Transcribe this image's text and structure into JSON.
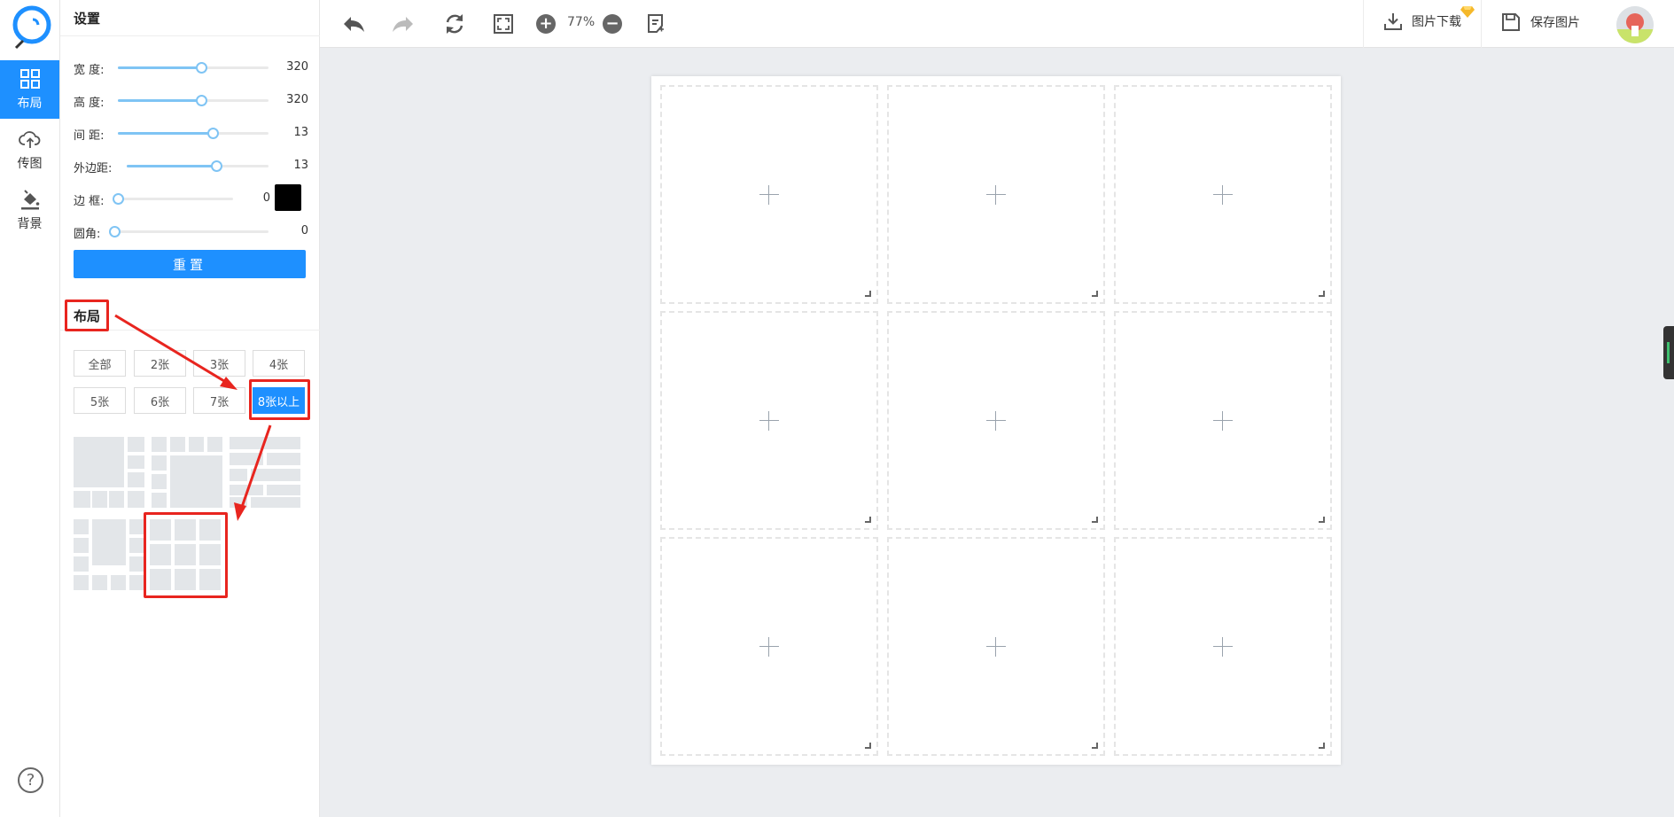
{
  "rail": {
    "items": [
      {
        "label": "布局",
        "icon": "grid-icon"
      },
      {
        "label": "传图",
        "icon": "cloud-upload-icon"
      },
      {
        "label": "背景",
        "icon": "paint-bucket-icon"
      }
    ],
    "help": "?"
  },
  "panel": {
    "title": "设置",
    "sliders": [
      {
        "label": "宽 度:",
        "value": "320",
        "level": 0.55
      },
      {
        "label": "高 度:",
        "value": "320",
        "level": 0.55
      },
      {
        "label": "间 距:",
        "value": "13",
        "level": 0.63
      },
      {
        "label": "外边距:",
        "value": "13",
        "level": 0.63
      },
      {
        "label": "边 框:",
        "value": "0",
        "level": 0
      },
      {
        "label": "圆角:",
        "value": "0",
        "level": 0
      }
    ],
    "border_color": "#000000",
    "reset_label": "重置",
    "layout_title": "布局",
    "filters": [
      "全部",
      "2张",
      "3张",
      "4张",
      "5张",
      "6张",
      "7张",
      "8张以上"
    ],
    "active_filter": "8张以上"
  },
  "toolbar": {
    "zoom": "77%",
    "zoom_in": "+",
    "zoom_out": "−",
    "download_label": "图片下载",
    "save_label": "保存图片"
  },
  "colors": {
    "accent": "#1e90ff",
    "annotation": "#e8251f"
  }
}
